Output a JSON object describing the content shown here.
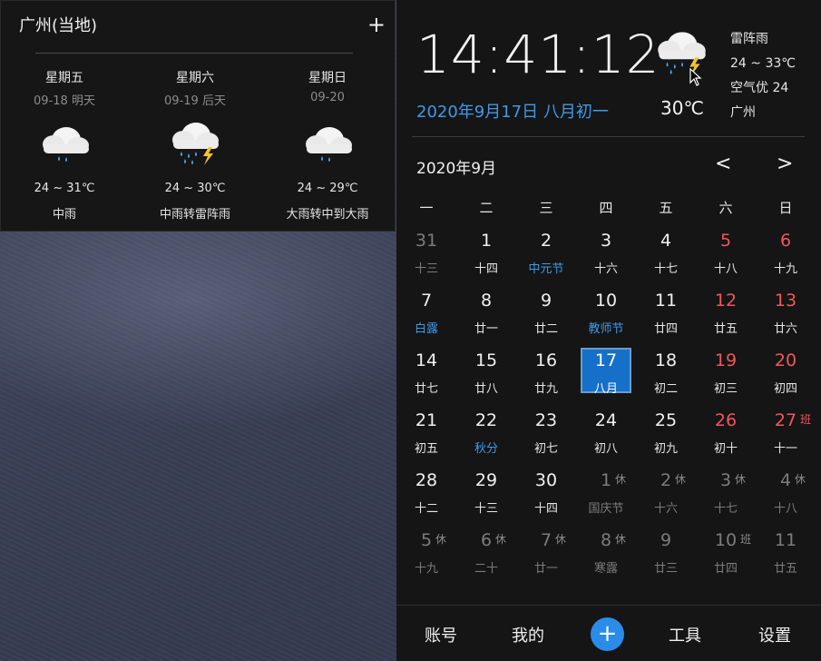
{
  "forecast": {
    "city": "广州(当地)",
    "add_label": "+",
    "days": [
      {
        "weekday": "星期五",
        "date": "09-18 明天",
        "icon": "rain-cloud-icon",
        "temp": "24 ~ 31℃",
        "desc": "中雨"
      },
      {
        "weekday": "星期六",
        "date": "09-19 后天",
        "icon": "thunder-rain-cloud-icon",
        "temp": "24 ~ 30℃",
        "desc": "中雨转雷阵雨"
      },
      {
        "weekday": "星期日",
        "date": "09-20",
        "icon": "rain-cloud-icon",
        "temp": "24 ~ 29℃",
        "desc": "大雨转中到大雨"
      }
    ]
  },
  "current": {
    "time": "14:41:12",
    "date": "2020年9月17日  八月初一",
    "temp": "30℃",
    "condition": "雷阵雨",
    "range": "24 ~ 33℃",
    "air": "空气优 24",
    "city": "广州",
    "icon": "thunder-rain-cloud-icon"
  },
  "calendar": {
    "month_label": "2020年9月",
    "prev": "<",
    "next": ">",
    "weekdays": [
      "一",
      "二",
      "三",
      "四",
      "五",
      "六",
      "日"
    ],
    "rows": [
      [
        {
          "d": "31",
          "l": "十三",
          "dim": true
        },
        {
          "d": "1",
          "l": "十四"
        },
        {
          "d": "2",
          "l": "中元节",
          "fest": true
        },
        {
          "d": "3",
          "l": "十六"
        },
        {
          "d": "4",
          "l": "十七"
        },
        {
          "d": "5",
          "l": "十八",
          "red": true
        },
        {
          "d": "6",
          "l": "十九",
          "red": true
        }
      ],
      [
        {
          "d": "7",
          "l": "白露",
          "fest": true
        },
        {
          "d": "8",
          "l": "廿一"
        },
        {
          "d": "9",
          "l": "廿二"
        },
        {
          "d": "10",
          "l": "教师节",
          "fest": true
        },
        {
          "d": "11",
          "l": "廿四"
        },
        {
          "d": "12",
          "l": "廿五",
          "red": true
        },
        {
          "d": "13",
          "l": "廿六",
          "red": true
        }
      ],
      [
        {
          "d": "14",
          "l": "廿七"
        },
        {
          "d": "15",
          "l": "廿八"
        },
        {
          "d": "16",
          "l": "廿九"
        },
        {
          "d": "17",
          "l": "八月",
          "today": true
        },
        {
          "d": "18",
          "l": "初二"
        },
        {
          "d": "19",
          "l": "初三",
          "red": true
        },
        {
          "d": "20",
          "l": "初四",
          "red": true
        }
      ],
      [
        {
          "d": "21",
          "l": "初五"
        },
        {
          "d": "22",
          "l": "秋分",
          "fest": true
        },
        {
          "d": "23",
          "l": "初七"
        },
        {
          "d": "24",
          "l": "初八"
        },
        {
          "d": "25",
          "l": "初九"
        },
        {
          "d": "26",
          "l": "初十",
          "red": true
        },
        {
          "d": "27",
          "l": "十一",
          "red": true,
          "tag": "班",
          "tagType": "work"
        }
      ],
      [
        {
          "d": "28",
          "l": "十二"
        },
        {
          "d": "29",
          "l": "十三"
        },
        {
          "d": "30",
          "l": "十四"
        },
        {
          "d": "1",
          "l": "国庆节",
          "dim": true,
          "fest": true,
          "tag": "休",
          "tagType": "rest"
        },
        {
          "d": "2",
          "l": "十六",
          "dim": true,
          "tag": "休",
          "tagType": "rest"
        },
        {
          "d": "3",
          "l": "十七",
          "dim": true,
          "tag": "休",
          "tagType": "rest"
        },
        {
          "d": "4",
          "l": "十八",
          "dim": true,
          "tag": "休",
          "tagType": "rest"
        }
      ],
      [
        {
          "d": "5",
          "l": "十九",
          "dim": true,
          "tag": "休",
          "tagType": "rest"
        },
        {
          "d": "6",
          "l": "二十",
          "dim": true,
          "tag": "休",
          "tagType": "rest"
        },
        {
          "d": "7",
          "l": "廿一",
          "dim": true,
          "tag": "休",
          "tagType": "rest"
        },
        {
          "d": "8",
          "l": "寒露",
          "dim": true,
          "fest": true,
          "tag": "休",
          "tagType": "rest"
        },
        {
          "d": "9",
          "l": "廿三",
          "dim": true
        },
        {
          "d": "10",
          "l": "廿四",
          "dim": true,
          "tag": "班",
          "tagType": "work"
        },
        {
          "d": "11",
          "l": "廿五",
          "dim": true
        }
      ]
    ]
  },
  "bottom_bar": {
    "account": "账号",
    "mine": "我的",
    "add": "+",
    "tools": "工具",
    "settings": "设置"
  },
  "colors": {
    "accent_blue": "#3d9be9",
    "weekend_red": "#f0575a",
    "today_bg": "#1670c9",
    "panel_bg": "#151515"
  }
}
